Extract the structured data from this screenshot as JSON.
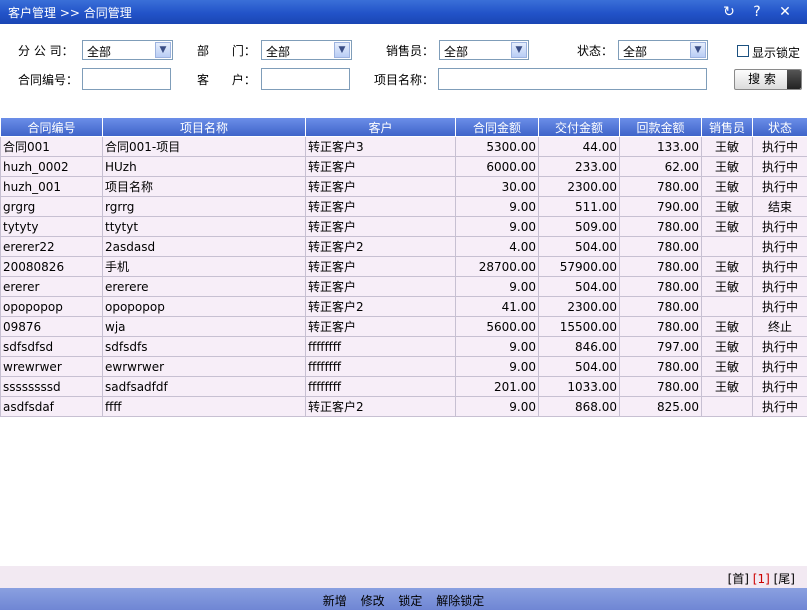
{
  "title": {
    "breadcrumb": "客户管理 >> 合同管理",
    "refresh_glyph": "↻",
    "help_glyph": "?",
    "close_glyph": "✕"
  },
  "filters": {
    "branch_label": "分 公 司：",
    "branch_value": "全部",
    "dept_label": "部      门：",
    "dept_value": "全部",
    "salesperson_label": "销售员：",
    "salesperson_value": "全部",
    "status_label": "状态：",
    "status_value": "全部",
    "show_locked_label": "显示锁定",
    "contract_no_label": "合同编号：",
    "customer_label": "客      户：",
    "project_name_label": "项目名称：",
    "search_button": "搜 索"
  },
  "table": {
    "columns": [
      "合同编号",
      "项目名称",
      "客户",
      "合同金额",
      "交付金额",
      "回款金额",
      "销售员",
      "状态"
    ],
    "rows": [
      [
        "合同001",
        "合同001-项目",
        "转正客户3",
        "5300.00",
        "44.00",
        "133.00",
        "王敏",
        "执行中"
      ],
      [
        "huzh_0002",
        "HUzh",
        "转正客户",
        "6000.00",
        "233.00",
        "62.00",
        "王敏",
        "执行中"
      ],
      [
        "huzh_001",
        "项目名称",
        "转正客户",
        "30.00",
        "2300.00",
        "780.00",
        "王敏",
        "执行中"
      ],
      [
        "grgrg",
        "rgrrg",
        "转正客户",
        "9.00",
        "511.00",
        "790.00",
        "王敏",
        "结束"
      ],
      [
        "tytyty",
        "ttytyt",
        "转正客户",
        "9.00",
        "509.00",
        "780.00",
        "王敏",
        "执行中"
      ],
      [
        "ererer22",
        "2asdasd",
        "转正客户2",
        "4.00",
        "504.00",
        "780.00",
        "",
        "执行中"
      ],
      [
        "20080826",
        "手机",
        "转正客户",
        "28700.00",
        "57900.00",
        "780.00",
        "王敏",
        "执行中"
      ],
      [
        "ererer",
        "ererere",
        "转正客户",
        "9.00",
        "504.00",
        "780.00",
        "王敏",
        "执行中"
      ],
      [
        "opopopop",
        "opopopop",
        "转正客户2",
        "41.00",
        "2300.00",
        "780.00",
        "",
        "执行中"
      ],
      [
        "09876",
        "wja",
        "转正客户",
        "5600.00",
        "15500.00",
        "780.00",
        "王敏",
        "终止"
      ],
      [
        "sdfsdfsd",
        "sdfsdfs",
        "ffffffff",
        "9.00",
        "846.00",
        "797.00",
        "王敏",
        "执行中"
      ],
      [
        "wrewrwer",
        "ewrwrwer",
        "ffffffff",
        "9.00",
        "504.00",
        "780.00",
        "王敏",
        "执行中"
      ],
      [
        "ssssssssd",
        "sadfsadfdf",
        "ffffffff",
        "201.00",
        "1033.00",
        "780.00",
        "王敏",
        "执行中"
      ],
      [
        "asdfsdaf",
        "ffff",
        "转正客户2",
        "9.00",
        "868.00",
        "825.00",
        "",
        "执行中"
      ]
    ]
  },
  "pager": {
    "first": "[首]",
    "current": "[1]",
    "last": "[尾]"
  },
  "actions": {
    "add": "新增",
    "edit": "修改",
    "lock": "锁定",
    "unlock": "解除锁定"
  }
}
